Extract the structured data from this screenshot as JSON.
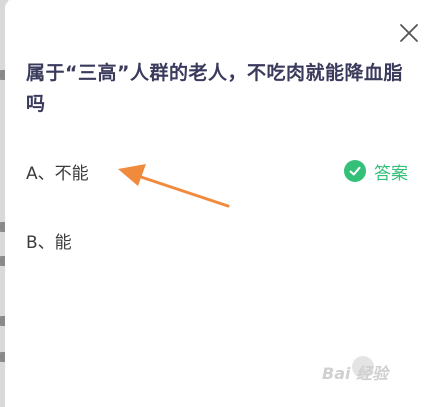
{
  "dialog": {
    "question": "属于“三高”人群的老人，不吃肉就能降血脂吗",
    "close_icon": "close-icon",
    "options": [
      {
        "label": "A、不能",
        "is_answer": true
      },
      {
        "label": "B、能",
        "is_answer": false
      }
    ],
    "answer_label": "答案",
    "answer_icon": "check-circle-icon"
  },
  "annotation": {
    "arrow_icon": "pointer-arrow-icon",
    "arrow_color": "#f08a3c"
  },
  "watermark": {
    "text": "Bai  经验"
  },
  "colors": {
    "question": "#3a3a5c",
    "answer_green": "#35c07a",
    "option_text": "#3c3c3c"
  }
}
